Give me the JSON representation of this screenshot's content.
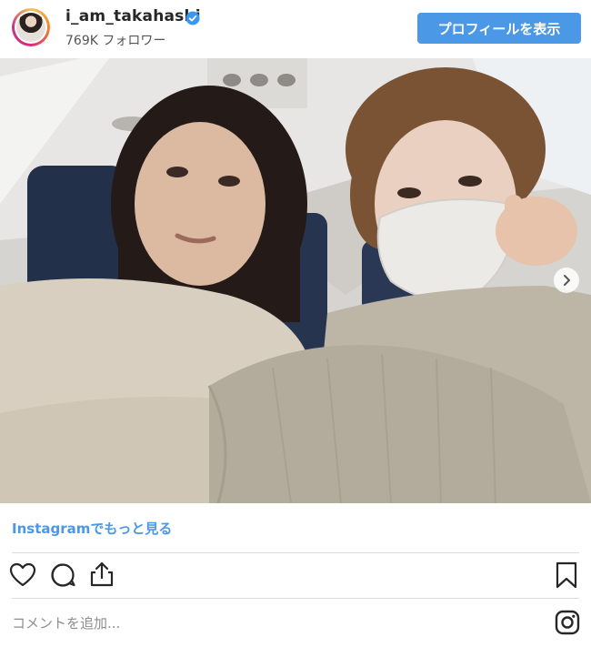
{
  "post_header": {
    "username": "i_am_takahashi",
    "followers": "769K フォロワー",
    "profile_button": "プロフィールを表示"
  },
  "post": {
    "more_link": "Instagramでもっと見る",
    "comment_placeholder": "コメントを追加..."
  },
  "icons": {
    "verified": "verified-badge-icon",
    "next": "chevron-right-icon",
    "like": "heart-icon",
    "comment": "comment-icon",
    "share": "share-icon",
    "save": "bookmark-icon",
    "brand": "instagram-logo-icon"
  },
  "colors": {
    "accent": "#4a98e6",
    "text": "#262626",
    "muted": "#8e8e8e",
    "divider": "#dbdbdb"
  }
}
